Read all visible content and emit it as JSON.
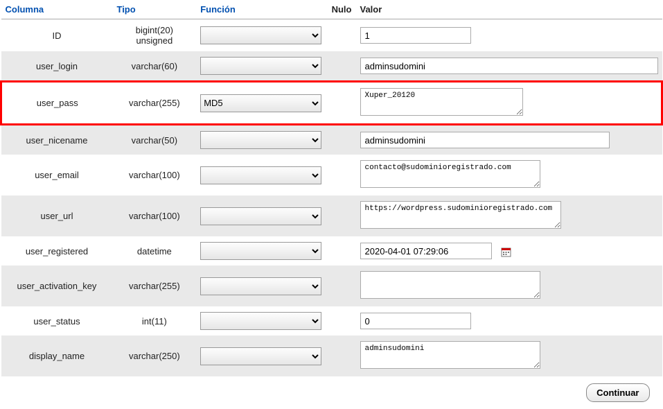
{
  "headers": {
    "columna": "Columna",
    "tipo": "Tipo",
    "funcion": "Función",
    "nulo": "Nulo",
    "valor": "Valor"
  },
  "rows": {
    "id": {
      "columna": "ID",
      "tipo": "bigint(20) unsigned",
      "funcion": "",
      "valor": "1"
    },
    "user_login": {
      "columna": "user_login",
      "tipo": "varchar(60)",
      "funcion": "",
      "valor": "adminsudomini"
    },
    "user_pass": {
      "columna": "user_pass",
      "tipo": "varchar(255)",
      "funcion": "MD5",
      "valor": "Xuper_20120"
    },
    "user_nicename": {
      "columna": "user_nicename",
      "tipo": "varchar(50)",
      "funcion": "",
      "valor": "adminsudomini"
    },
    "user_email": {
      "columna": "user_email",
      "tipo": "varchar(100)",
      "funcion": "",
      "valor": "contacto@sudominioregistrado.com"
    },
    "user_url": {
      "columna": "user_url",
      "tipo": "varchar(100)",
      "funcion": "",
      "valor": "https://wordpress.sudominioregistrado.com"
    },
    "user_registered": {
      "columna": "user_registered",
      "tipo": "datetime",
      "funcion": "",
      "valor": "2020-04-01 07:29:06"
    },
    "user_activation_key": {
      "columna": "user_activation_key",
      "tipo": "varchar(255)",
      "funcion": "",
      "valor": ""
    },
    "user_status": {
      "columna": "user_status",
      "tipo": "int(11)",
      "funcion": "",
      "valor": "0"
    },
    "display_name": {
      "columna": "display_name",
      "tipo": "varchar(250)",
      "funcion": "",
      "valor": "adminsudomini"
    }
  },
  "footer": {
    "continuar": "Continuar"
  }
}
